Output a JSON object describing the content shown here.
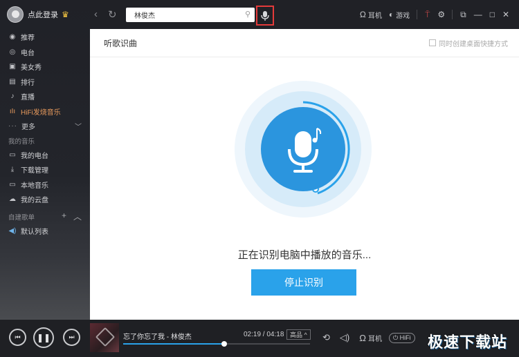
{
  "user": {
    "name": "点此登录",
    "vip_icon": "crown-icon"
  },
  "sidebar": {
    "items": [
      {
        "label": "推荐",
        "icon": "disc-icon"
      },
      {
        "label": "电台",
        "icon": "radio-icon"
      },
      {
        "label": "美女秀",
        "icon": "play-square-icon"
      },
      {
        "label": "排行",
        "icon": "chart-icon"
      },
      {
        "label": "直播",
        "icon": "mic-icon"
      },
      {
        "label": "HiFi发烧音乐",
        "icon": "hifi-icon",
        "active": true
      }
    ],
    "more": "更多",
    "my_music_title": "我的音乐",
    "my_music": [
      {
        "label": "我的电台",
        "icon": "radio-icon"
      },
      {
        "label": "下载管理",
        "icon": "download-icon"
      },
      {
        "label": "本地音乐",
        "icon": "monitor-icon"
      },
      {
        "label": "我的云盘",
        "icon": "cloud-icon"
      }
    ],
    "playlist_title": "自建歌单",
    "playlists": [
      {
        "label": "默认列表",
        "icon": "speaker-icon"
      }
    ]
  },
  "topbar": {
    "search_value": "林俊杰",
    "right": [
      {
        "label": "耳机",
        "icon": "headphones-icon"
      },
      {
        "label": "游戏",
        "icon": "game-icon"
      }
    ]
  },
  "main": {
    "title": "听歌识曲",
    "desktop_shortcut": "同时创建桌面快捷方式",
    "status": "正在识别电脑中播放的音乐...",
    "stop_button": "停止识别"
  },
  "player": {
    "song": "忘了你忘了我 - 林俊杰",
    "time": "02:19 / 04:18",
    "quality": "高品",
    "progress": 0.54,
    "earphone": "耳机",
    "hifi": "HiFi"
  },
  "watermark": "极速下载站",
  "colors": {
    "accent": "#2aa2ea",
    "active_nav": "#e99b5d",
    "highlight": "#e43a3a"
  }
}
